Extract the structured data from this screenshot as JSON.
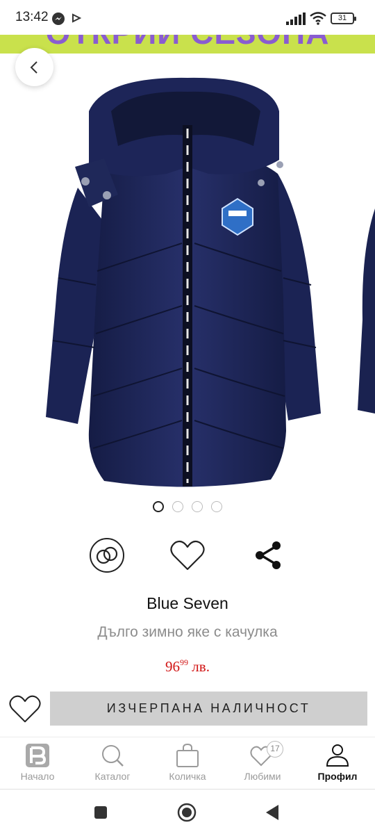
{
  "status_bar": {
    "time": "13:42",
    "battery": "31",
    "icons": [
      "messenger-icon",
      "cast-icon",
      "signal-icon",
      "wifi-icon",
      "battery-icon"
    ]
  },
  "promo_banner": {
    "text": "ОТКРИЙ СЕЗОНА",
    "background": "#c9e14c",
    "text_color": "#8a5cd0"
  },
  "gallery": {
    "image_count": 4,
    "active_index": 0,
    "image_icon": "navy-hooded-winter-jacket-image"
  },
  "product": {
    "brand": "Blue Seven",
    "name": "Дълго зимно яке с качулка",
    "price_main": "96",
    "price_cents": "99",
    "price_currency": "лв.",
    "price_color": "#d11414"
  },
  "actions": {
    "compare_icon": "compare-rings-icon",
    "favorite_icon": "heart-icon",
    "share_icon": "share-icon"
  },
  "cta": {
    "label": "ИЗЧЕРПАНА НАЛИЧНОСТ",
    "background": "#cfcfcf"
  },
  "bottom_nav": {
    "items": [
      {
        "label": "Начало",
        "icon": "home-logo-icon",
        "active": false
      },
      {
        "label": "Каталог",
        "icon": "search-icon",
        "active": false
      },
      {
        "label": "Количка",
        "icon": "shopping-bag-icon",
        "active": false
      },
      {
        "label": "Любими",
        "icon": "heart-icon",
        "active": false,
        "badge": "17"
      },
      {
        "label": "Профил",
        "icon": "profile-icon",
        "active": true
      }
    ]
  },
  "system_nav": {
    "icons": [
      "recents-square-icon",
      "home-circle-icon",
      "back-triangle-icon"
    ]
  }
}
